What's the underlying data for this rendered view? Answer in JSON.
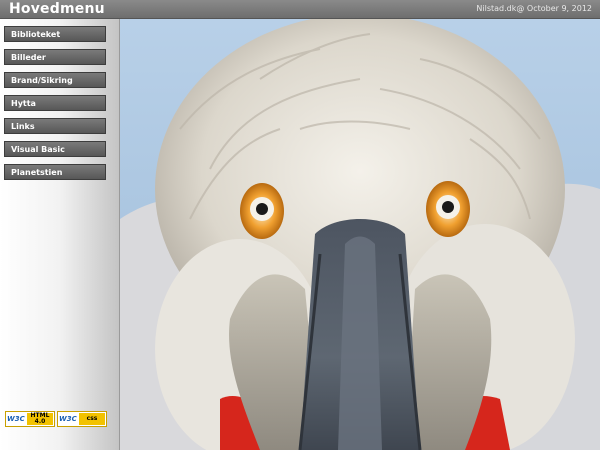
{
  "header": {
    "title": "Hovedmenu",
    "info": "Nilstad.dk@ October 9, 2012"
  },
  "sidebar": {
    "items": [
      {
        "label": "Biblioteket"
      },
      {
        "label": "Billeder"
      },
      {
        "label": "Brand/Sikring"
      },
      {
        "label": "Hytta"
      },
      {
        "label": "Links"
      },
      {
        "label": "Visual Basic"
      },
      {
        "label": "Planetstien"
      }
    ]
  },
  "badges": {
    "html": {
      "w3c": "W3C",
      "tag": "HTML 4.0"
    },
    "css": {
      "w3c": "W3C",
      "tag": "css"
    }
  },
  "colors": {
    "header": "#7a7a7a",
    "button": "#5f5f5f",
    "badge_accent": "#f2c200",
    "sky": "#a9c6e0"
  }
}
